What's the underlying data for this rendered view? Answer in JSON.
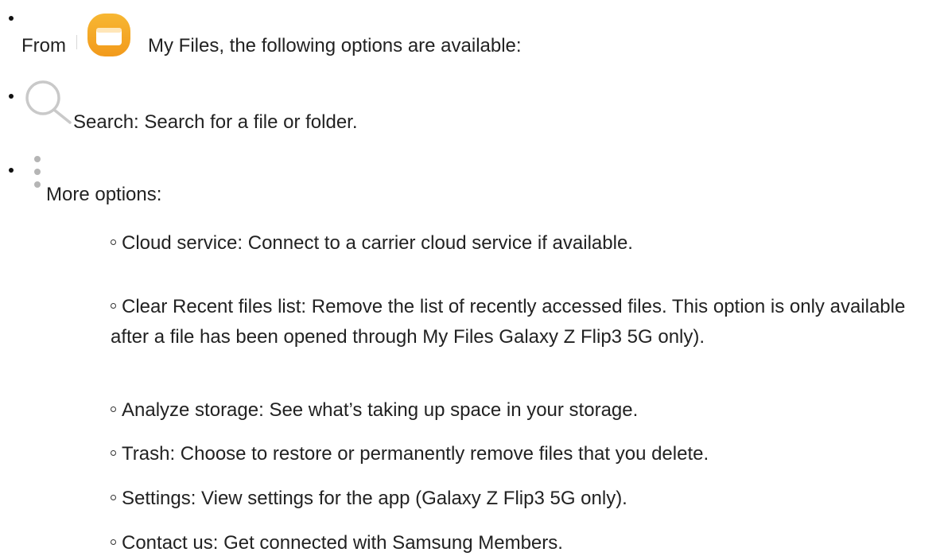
{
  "intro": {
    "before_icon": "From",
    "after_icon": "My Files, the following options are available:",
    "icon": "my-files-folder-icon",
    "icon_color": "#f5a623"
  },
  "items": [
    {
      "icon": "search-icon",
      "text": "Search: Search for a file or folder."
    },
    {
      "icon": "more-options-icon",
      "text": "More options:"
    }
  ],
  "sub_items": [
    "Cloud service: Connect to a carrier cloud service if available.",
    "Clear Recent files list: Remove the list of recently accessed files. This option is only available after a file has been opened through My Files Galaxy Z Flip3 5G only).",
    "Analyze storage: See what’s taking up space in your storage.",
    "Trash: Choose to restore or permanently remove files that you delete.",
    "Settings: View settings for the app (Galaxy Z Flip3 5G only).",
    "Contact us: Get connected with Samsung Members."
  ]
}
